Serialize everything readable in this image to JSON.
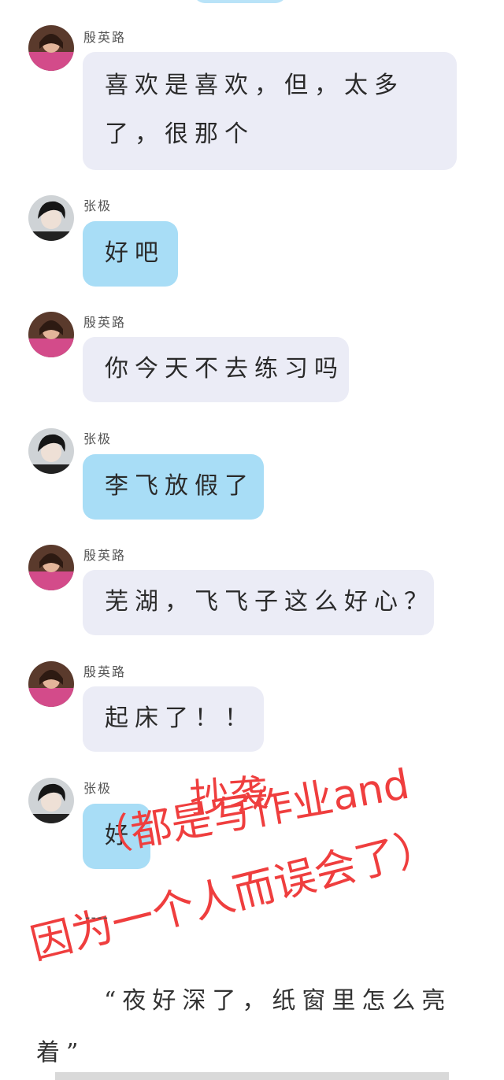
{
  "messages": [
    {
      "sender": "殷英路",
      "text_lines": [
        "喜欢是喜欢，但，太多",
        "了，很那个"
      ],
      "style": "gray"
    },
    {
      "sender": "张极",
      "text_lines": [
        "好吧"
      ],
      "style": "blue"
    },
    {
      "sender": "殷英路",
      "text_lines": [
        "你今天不去练习吗"
      ],
      "style": "gray"
    },
    {
      "sender": "张极",
      "text_lines": [
        "李飞放假了"
      ],
      "style": "blue"
    },
    {
      "sender": "殷英路",
      "text_lines": [
        "芜湖，飞飞子这么好心？"
      ],
      "style": "gray"
    },
    {
      "sender": "殷英路",
      "text_lines": [
        "起床了！！"
      ],
      "style": "gray"
    },
    {
      "sender": "张极",
      "text_lines": [
        "好"
      ],
      "style": "blue"
    }
  ],
  "overlay": {
    "line1": "抄袭",
    "line2": "（都是写作业and",
    "line3": "因为一个人而误会了）",
    "color": "#ef3e3e"
  },
  "separator": "----",
  "novel": {
    "line1": "“夜好深了，纸窗里怎么亮",
    "line2": "着”"
  },
  "colors": {
    "gray_bubble": "#ebecf6",
    "blue_bubble": "#a8ddf6"
  }
}
